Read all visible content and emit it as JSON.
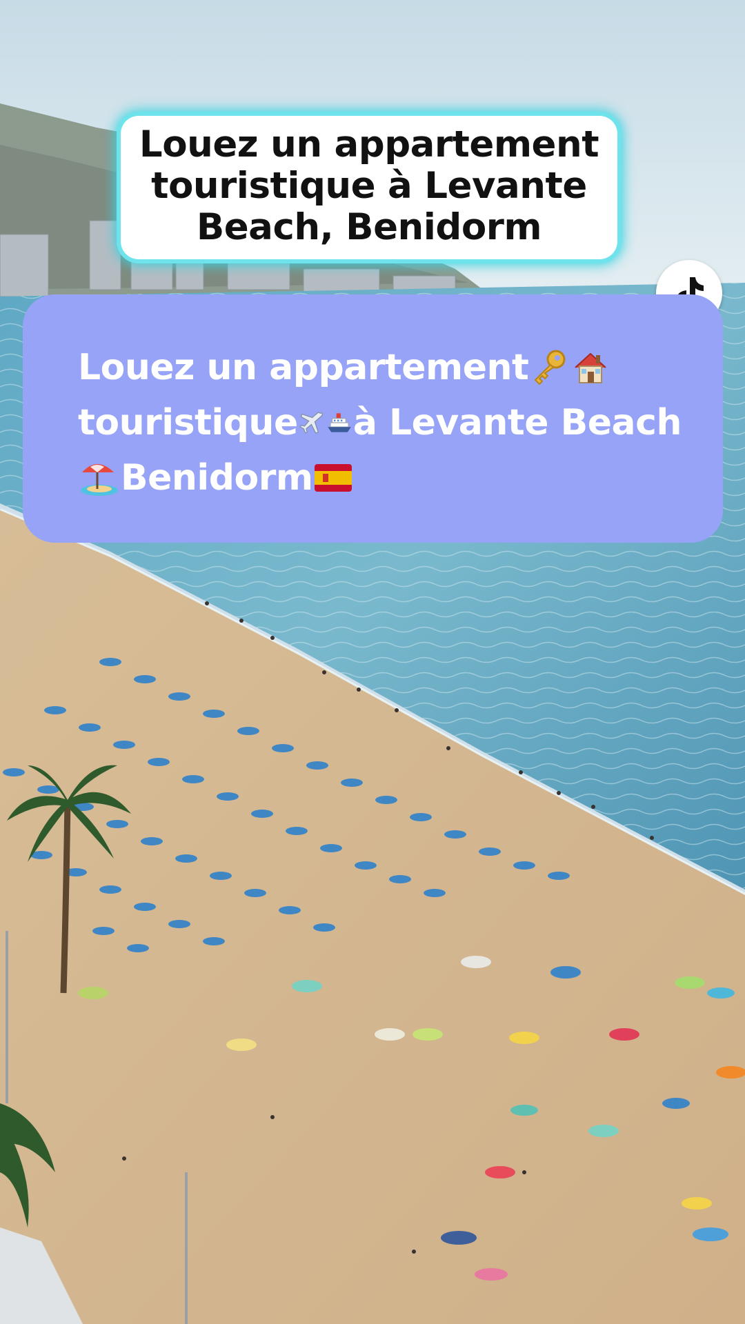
{
  "overlay": {
    "title_text": "Louez un appartement\ntouristique à Levante\nBeach, Benidorm",
    "caption": {
      "line1_text": "Louez un appartement",
      "line2_text": "touristique",
      "line2_tail": " à Levante Beach",
      "line3_text": "Benidorm "
    },
    "caption_color": "#97a3f6",
    "glow_color": "#37d3e0"
  },
  "icons": {
    "logo": "tiktok-icon",
    "emojis": [
      "key-icon",
      "house-icon",
      "airplane-icon",
      "ship-icon",
      "beach-umbrella-icon",
      "spain-flag-icon"
    ]
  }
}
